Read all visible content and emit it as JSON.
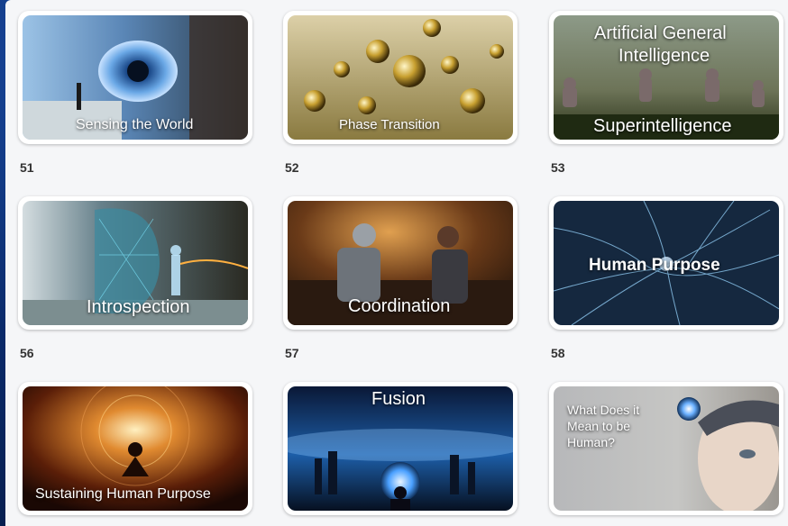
{
  "tiles": [
    {
      "number": "51",
      "caption": "Sensing the World"
    },
    {
      "number": "52",
      "caption": "Phase Transition"
    },
    {
      "number": "53",
      "caption_top_line1": "Artificial General",
      "caption_top_line2": "Intelligence",
      "caption": "Superintelligence"
    },
    {
      "number": "56",
      "caption": "Introspection"
    },
    {
      "number": "57",
      "caption": "Coordination"
    },
    {
      "number": "58",
      "caption": "Human Purpose"
    },
    {
      "caption": "Sustaining Human Purpose"
    },
    {
      "caption": "Fusion"
    },
    {
      "caption_line1": "What Does it",
      "caption_line2": "Mean to be",
      "caption_line3": "Human?"
    }
  ]
}
